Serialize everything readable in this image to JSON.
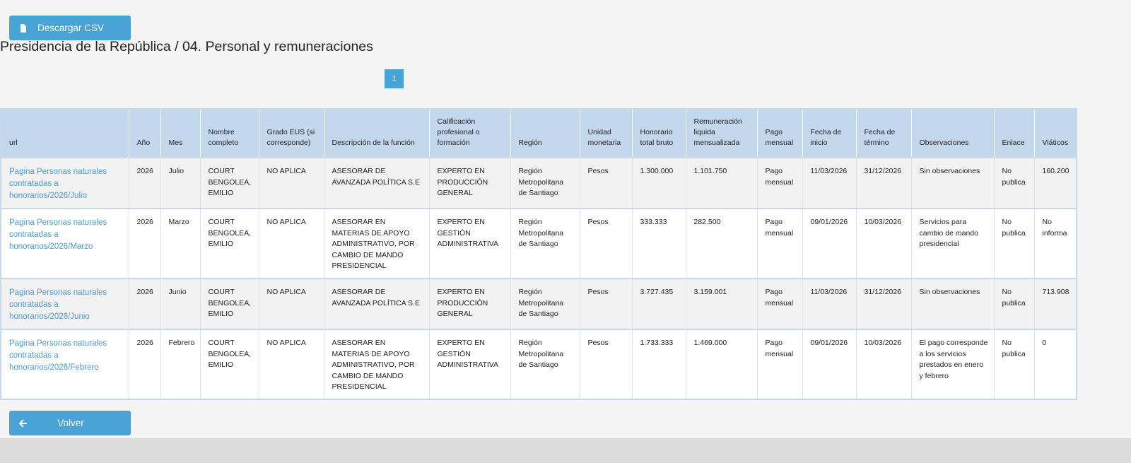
{
  "download_button": {
    "label": "Descargar CSV",
    "icon": "file-icon"
  },
  "page_title": "Presidencia de la República / 04. Personal y remuneraciones",
  "pagination": {
    "current": "1"
  },
  "table": {
    "headers": [
      "url",
      "Año",
      "Mes",
      "Nombre completo",
      "Grado EUS (si corresponde)",
      "Descripción de la función",
      "Calificación profesional o formación",
      "Región",
      "Unidad monetaria",
      "Honorario total bruto",
      "Remuneración liquida mensualizada",
      "Pago mensual",
      "Fecha de inicio",
      "Fecha de término",
      "Observaciones",
      "Enlace",
      "Viáticos"
    ],
    "rows": [
      [
        "Pagina Personas naturales contratadas a honorarios/2026/Julio",
        "2026",
        "Julio",
        "COURT BENGOLEA, EMILIO",
        "NO APLICA",
        "ASESORAR DE AVANZADA POLÍTICA S.E",
        "EXPERTO EN PRODUCCIÓN GENERAL",
        "Región Metropolitana de Santiago",
        "Pesos",
        "1.300.000",
        "1.101.750",
        "Pago mensual",
        "11/03/2026",
        "31/12/2026",
        "Sin observaciones",
        "No publica",
        "160.200"
      ],
      [
        "Pagina Personas naturales contratadas a honorarios/2026/Marzo",
        "2026",
        "Marzo",
        "COURT BENGOLEA, EMILIO",
        "NO APLICA",
        "ASESORAR EN MATERIAS DE APOYO ADMINISTRATIVO, POR CAMBIO DE MANDO PRESIDENCIAL",
        "EXPERTO EN GESTIÓN ADMINISTRATIVA",
        "Región Metropolitana de Santiago",
        "Pesos",
        "333.333",
        "282.500",
        "Pago mensual",
        "09/01/2026",
        "10/03/2026",
        "Servicios para cambio de mando presidencial",
        "No publica",
        "No informa"
      ],
      [
        "Pagina Personas naturales contratadas a honorarios/2026/Junio",
        "2026",
        "Junio",
        "COURT BENGOLEA, EMILIO",
        "NO APLICA",
        "ASESORAR DE AVANZADA POLÍTICA S.E",
        "EXPERTO EN PRODUCCIÓN GENERAL",
        "Región Metropolitana de Santiago",
        "Pesos",
        "3.727.435",
        "3.159.001",
        "Pago mensual",
        "11/03/2026",
        "31/12/2026",
        "Sin observaciones",
        "No publica",
        "713.908"
      ],
      [
        "Pagina Personas naturales contratadas a honorarios/2026/Febrero",
        "2026",
        "Febrero",
        "COURT BENGOLEA, EMILIO",
        "NO APLICA",
        "ASESORAR EN MATERIAS DE APOYO ADMINISTRATIVO, POR CAMBIO DE MANDO PRESIDENCIAL",
        "EXPERTO EN GESTIÓN ADMINISTRATIVA",
        "Región Metropolitana de Santiago",
        "Pesos",
        "1.733.333",
        "1.469.000",
        "Pago mensual",
        "09/01/2026",
        "10/03/2026",
        "El pago corresponde a los servicios prestados en enero y febrero",
        "No publica",
        "0"
      ]
    ]
  },
  "back_button": {
    "label": "Volver",
    "icon": "arrow-left-icon"
  },
  "colors": {
    "accent": "#4aa3d6",
    "header_bg": "#c3d7ed",
    "link": "#4c9bd1"
  }
}
